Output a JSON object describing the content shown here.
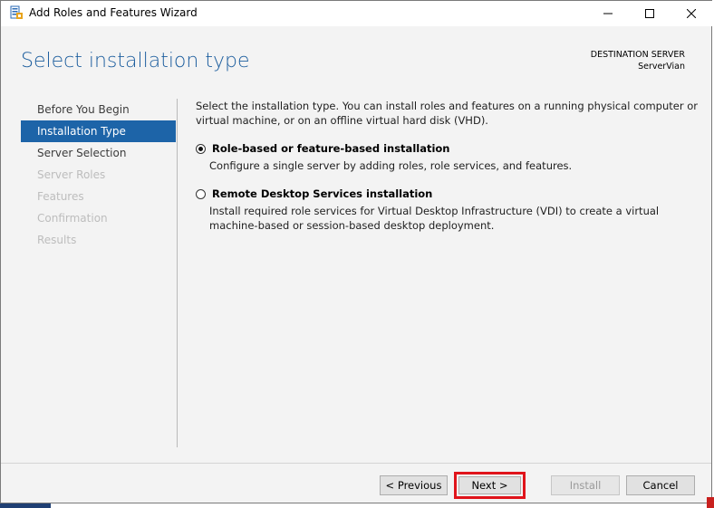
{
  "window": {
    "title": "Add Roles and Features Wizard"
  },
  "header": {
    "page_title": "Select installation type",
    "destination_label": "DESTINATION SERVER",
    "destination_server": "ServerVian"
  },
  "nav": {
    "items": [
      {
        "label": "Before You Begin",
        "state": "done"
      },
      {
        "label": "Installation Type",
        "state": "active"
      },
      {
        "label": "Server Selection",
        "state": "done"
      },
      {
        "label": "Server Roles",
        "state": "pending"
      },
      {
        "label": "Features",
        "state": "pending"
      },
      {
        "label": "Confirmation",
        "state": "pending"
      },
      {
        "label": "Results",
        "state": "pending"
      }
    ]
  },
  "content": {
    "intro": "Select the installation type. You can install roles and features on a running physical computer or virtual machine, or on an offline virtual hard disk (VHD).",
    "options": [
      {
        "title": "Role-based or feature-based installation",
        "description": "Configure a single server by adding roles, role services, and features.",
        "selected": true
      },
      {
        "title": "Remote Desktop Services installation",
        "description": "Install required role services for Virtual Desktop Infrastructure (VDI) to create a virtual machine-based or session-based desktop deployment.",
        "selected": false
      }
    ]
  },
  "footer": {
    "previous_label": "< Previous",
    "next_label": "Next >",
    "install_label": "Install",
    "cancel_label": "Cancel"
  },
  "colors": {
    "accent": "#1d64a8",
    "title_blue": "#1d5e9e",
    "highlight_red": "#e0141b"
  },
  "icons": {
    "app": "server-manager-icon",
    "minimize": "minimize-icon",
    "maximize": "maximize-icon",
    "close": "close-icon"
  }
}
